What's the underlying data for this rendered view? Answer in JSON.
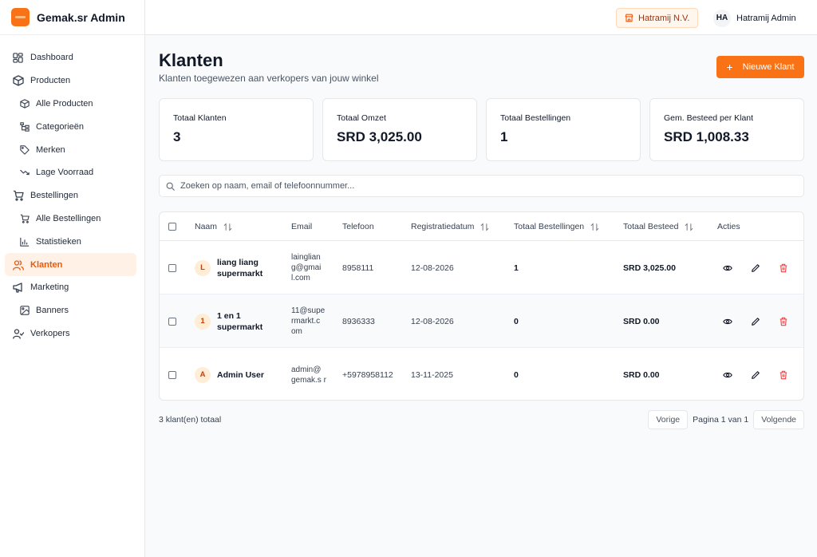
{
  "brand": {
    "title": "Gemak.sr Admin"
  },
  "topbar": {
    "store": "Hatramij N.V.",
    "user_initials": "HA",
    "user_name": "Hatramij Admin"
  },
  "sidebar": {
    "items": [
      {
        "label": "Dashboard",
        "icon": "dashboard-icon"
      },
      {
        "label": "Producten",
        "icon": "package-icon"
      },
      {
        "label": "Alle Producten",
        "icon": "box-icon"
      },
      {
        "label": "Categorieën",
        "icon": "category-tree-icon"
      },
      {
        "label": "Merken",
        "icon": "tag-icon"
      },
      {
        "label": "Lage Voorraad",
        "icon": "trending-down-icon"
      },
      {
        "label": "Bestellingen",
        "icon": "cart-icon"
      },
      {
        "label": "Alle Bestellingen",
        "icon": "cart-icon"
      },
      {
        "label": "Statistieken",
        "icon": "bar-chart-icon"
      },
      {
        "label": "Klanten",
        "icon": "users-icon"
      },
      {
        "label": "Marketing",
        "icon": "megaphone-icon"
      },
      {
        "label": "Banners",
        "icon": "image-icon"
      },
      {
        "label": "Verkopers",
        "icon": "user-check-icon"
      }
    ]
  },
  "page": {
    "title": "Klanten",
    "subtitle": "Klanten toegewezen aan verkopers van jouw winkel",
    "new_button": "Nieuwe Klant"
  },
  "stats": [
    {
      "label": "Totaal Klanten",
      "value": "3"
    },
    {
      "label": "Totaal Omzet",
      "value": "SRD 3,025.00"
    },
    {
      "label": "Totaal Bestellingen",
      "value": "1"
    },
    {
      "label": "Gem. Besteed per Klant",
      "value": "SRD 1,008.33"
    }
  ],
  "search": {
    "placeholder": "Zoeken op naam, email of telefoonnummer..."
  },
  "table": {
    "headers": [
      "Naam",
      "Email",
      "Telefoon",
      "Registratiedatum",
      "Totaal Bestellingen",
      "Totaal Besteed",
      "Acties"
    ],
    "rows": [
      {
        "initial": "L",
        "name": "liang liang supermarkt",
        "email": "lainglian g@gmai l.com",
        "phone": "8958111",
        "date": "12-08-2026",
        "orders": "1",
        "spent": "SRD 3,025.00"
      },
      {
        "initial": "1",
        "name": "1 en 1 supermarkt",
        "email": "11@supe rmarkt.c om",
        "phone": "8936333",
        "date": "12-08-2026",
        "orders": "0",
        "spent": "SRD 0.00"
      },
      {
        "initial": "A",
        "name": "Admin User",
        "email": "admin@ gemak.s r",
        "phone": "+5978958112",
        "date": "13-11-2025",
        "orders": "0",
        "spent": "SRD 0.00"
      }
    ]
  },
  "footer": {
    "count": "3 klant(en) totaal",
    "prev": "Vorige",
    "page_info": "Pagina 1 van 1",
    "next": "Volgende"
  }
}
